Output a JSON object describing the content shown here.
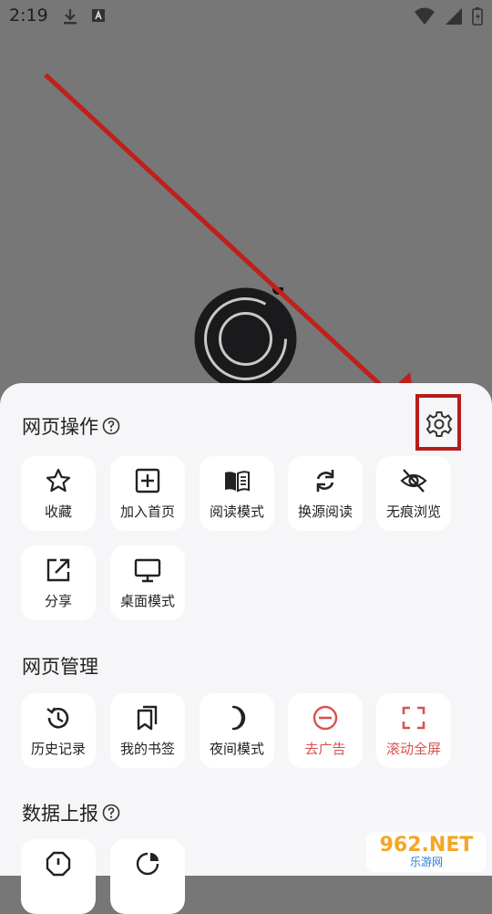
{
  "status_bar": {
    "time": "2:19"
  },
  "sections": {
    "page_ops": {
      "title": "网页操作",
      "items": [
        {
          "label": "收藏",
          "icon": "star-icon"
        },
        {
          "label": "加入首页",
          "icon": "plus-square-icon"
        },
        {
          "label": "阅读模式",
          "icon": "book-icon"
        },
        {
          "label": "换源阅读",
          "icon": "refresh-icon"
        },
        {
          "label": "无痕浏览",
          "icon": "eye-off-icon"
        },
        {
          "label": "分享",
          "icon": "share-icon"
        },
        {
          "label": "桌面模式",
          "icon": "monitor-icon"
        }
      ]
    },
    "page_manage": {
      "title": "网页管理",
      "items": [
        {
          "label": "历史记录",
          "icon": "history-icon"
        },
        {
          "label": "我的书签",
          "icon": "bookmarks-icon"
        },
        {
          "label": "夜间模式",
          "icon": "moon-icon"
        },
        {
          "label": "去广告",
          "icon": "block-icon"
        },
        {
          "label": "滚动全屏",
          "icon": "fullscreen-icon"
        }
      ]
    },
    "data_report": {
      "title": "数据上报"
    }
  },
  "colors": {
    "accent_red": "#d9534f",
    "annotation": "#b71c1c"
  },
  "watermark": {
    "main": "962.NET",
    "sub": "乐游网"
  }
}
